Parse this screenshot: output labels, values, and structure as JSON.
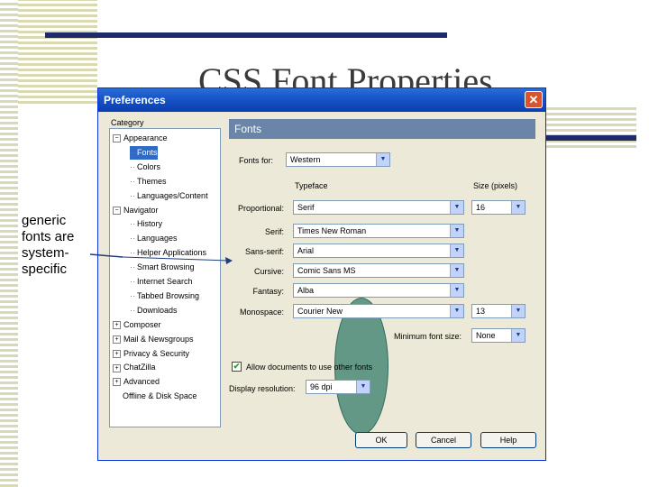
{
  "slide": {
    "title": "CSS Font Properties",
    "note": "generic fonts are system-specific"
  },
  "dialog": {
    "title": "Preferences",
    "category_label": "Category",
    "tree": [
      {
        "label": "Appearance",
        "level": 0,
        "toggle": "minus"
      },
      {
        "label": "Fonts",
        "level": 1,
        "selected": true
      },
      {
        "label": "Colors",
        "level": 1
      },
      {
        "label": "Themes",
        "level": 1
      },
      {
        "label": "Languages/Content",
        "level": 1
      },
      {
        "label": "Navigator",
        "level": 0,
        "toggle": "minus"
      },
      {
        "label": "History",
        "level": 1
      },
      {
        "label": "Languages",
        "level": 1
      },
      {
        "label": "Helper Applications",
        "level": 1
      },
      {
        "label": "Smart Browsing",
        "level": 1
      },
      {
        "label": "Internet Search",
        "level": 1
      },
      {
        "label": "Tabbed Browsing",
        "level": 1
      },
      {
        "label": "Downloads",
        "level": 1
      },
      {
        "label": "Composer",
        "level": 0,
        "toggle": "plus"
      },
      {
        "label": "Mail & Newsgroups",
        "level": 0,
        "toggle": "plus"
      },
      {
        "label": "Privacy & Security",
        "level": 0,
        "toggle": "plus"
      },
      {
        "label": "ChatZilla",
        "level": 0,
        "toggle": "plus"
      },
      {
        "label": "Advanced",
        "level": 0,
        "toggle": "plus"
      },
      {
        "label": "Offline & Disk Space",
        "level": 0
      }
    ],
    "panel_title": "Fonts",
    "fonts_for_label": "Fonts for:",
    "fonts_for_value": "Western",
    "typeface_header": "Typeface",
    "size_header": "Size (pixels)",
    "rows": [
      {
        "label": "Proportional:",
        "value": "Serif"
      },
      {
        "label": "Serif:",
        "value": "Times New Roman"
      },
      {
        "label": "Sans-serif:",
        "value": "Arial"
      },
      {
        "label": "Cursive:",
        "value": "Comic Sans MS"
      },
      {
        "label": "Fantasy:",
        "value": "Alba"
      },
      {
        "label": "Monospace:",
        "value": "Courier New"
      }
    ],
    "proportional_size": "16",
    "monospace_size": "13",
    "min_font_size_label": "Minimum font size:",
    "min_font_size_value": "None",
    "allow_fonts_label": "Allow documents to use other fonts",
    "allow_fonts_checked": true,
    "display_resolution_label": "Display resolution:",
    "display_resolution_value": "96 dpi",
    "ok_label": "OK",
    "cancel_label": "Cancel",
    "help_label": "Help",
    "close_glyph": "✕"
  }
}
